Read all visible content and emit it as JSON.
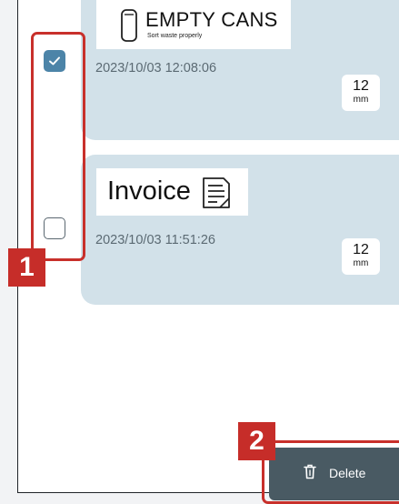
{
  "history": {
    "items": [
      {
        "label_title": "EMPTY CANS",
        "label_subtitle": "Sort waste properly",
        "timestamp": "2023/10/03 12:08:06",
        "size_value": "12",
        "size_unit": "mm",
        "checked": true
      },
      {
        "label_title": "Invoice",
        "timestamp": "2023/10/03 11:51:26",
        "size_value": "12",
        "size_unit": "mm",
        "checked": false
      }
    ]
  },
  "actions": {
    "delete_label": "Delete"
  },
  "callouts": {
    "first": "1",
    "second": "2"
  },
  "colors": {
    "card_background": "#d2e1e9",
    "checkbox_checked": "#4c84a8",
    "delete_button": "#495a63",
    "callout_red": "#c62d29"
  },
  "icons": {
    "can": "can-icon",
    "document": "document-icon",
    "checkmark": "checkmark-icon",
    "trash": "trash-icon"
  }
}
